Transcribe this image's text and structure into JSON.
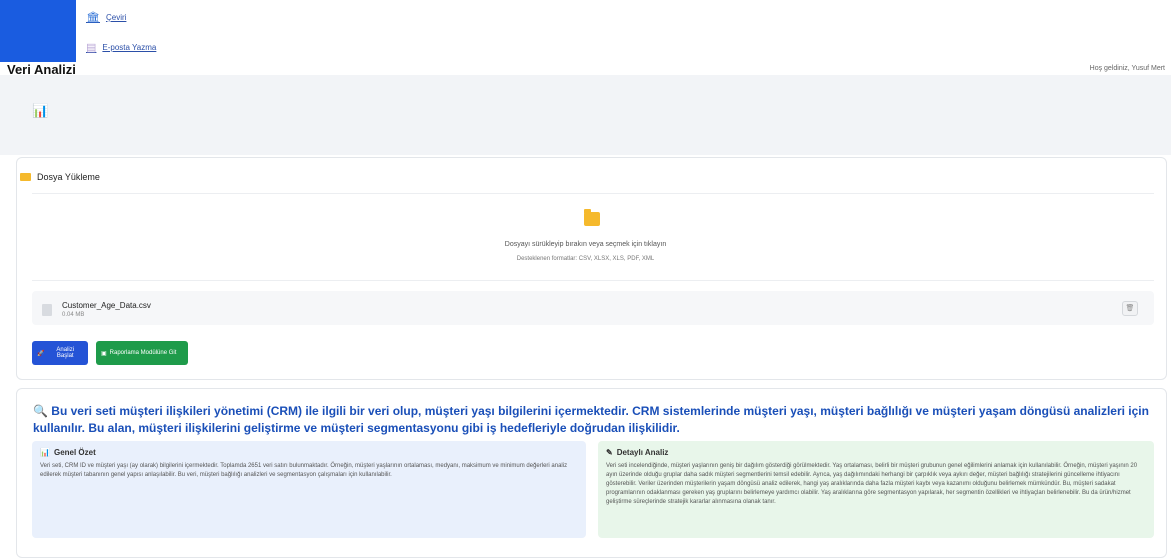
{
  "nav": {
    "items": [
      {
        "label": "Çeviri",
        "icon": "bank-icon"
      },
      {
        "label": "E-posta Yazma",
        "icon": "document-icon"
      }
    ]
  },
  "page_title": "Veri Analizi",
  "welcome": "Hoş geldiniz, Yusuf Mert",
  "upload": {
    "heading": "Dosya Yükleme",
    "drop_text": "Dosyayı sürükleyip bırakın veya seçmek için tıklayın",
    "formats": "Desteklenen formatlar: CSV, XLSX, XLS, PDF, XML",
    "file": {
      "name": "Customer_Age_Data.csv",
      "size": "0.04 MB"
    },
    "trash_icon": "🗑"
  },
  "buttons": {
    "analyze": "Analizi Başlat",
    "report": "Raporlama Modülüne Git"
  },
  "result": {
    "heading": "Bu veri seti müşteri ilişkileri yönetimi (CRM) ile ilgili bir veri olup, müşteri yaşı bilgilerini içermektedir. CRM sistemlerinde müşteri yaşı, müşteri bağlılığı ve müşteri yaşam döngüsü analizleri için kullanılır. Bu alan, müşteri ilişkilerini geliştirme ve müşteri segmentasyonu gibi iş hedefleriyle doğrudan ilişkilidir.",
    "summary_title": "Genel Özet",
    "summary_text": "Veri seti, CRM ID ve müşteri yaşı (ay olarak) bilgilerini içermektedir. Toplamda 2651 veri satırı bulunmaktadır. Örneğin, müşteri yaşlarının ortalaması, medyanı, maksimum ve minimum değerleri analiz edilerek müşteri tabanının genel yapısı anlaşılabilir. Bu veri, müşteri bağlılığı analizleri ve segmentasyon çalışmaları için kullanılabilir.",
    "detail_title": "Detaylı Analiz",
    "detail_text": "Veri seti incelendiğinde, müşteri yaşlarının geniş bir dağılım gösterdiği görülmektedir. Yaş ortalaması, belirli bir müşteri grubunun genel eğilimlerini anlamak için kullanılabilir. Örneğin, müşteri yaşının 20 ayın üzerinde olduğu gruplar daha sadık müşteri segmentlerini temsil edebilir. Ayrıca, yaş dağılımındaki herhangi bir çarpıklık veya aykırı değer, müşteri bağlılığı stratejilerini güncelleme ihtiyacını gösterebilir. Veriler üzerinden müşterilerin yaşam döngüsü analiz edilerek, hangi yaş aralıklarında daha fazla müşteri kaybı veya kazanımı olduğunu belirlemek mümkündür. Bu, müşteri sadakat programlarının odaklanması gereken yaş gruplarını belirlemeye yardımcı olabilir. Yaş aralıklarına göre segmentasyon yapılarak, her segmentin özellikleri ve ihtiyaçları belirlenebilir. Bu da ürün/hizmet geliştirme süreçlerinde stratejik kararlar alınmasına olanak tanır."
  },
  "colors": {
    "brand": "#1a5ce0",
    "analyze": "#2453d6",
    "report": "#1e9b4a",
    "heading": "#1a4fb8"
  }
}
